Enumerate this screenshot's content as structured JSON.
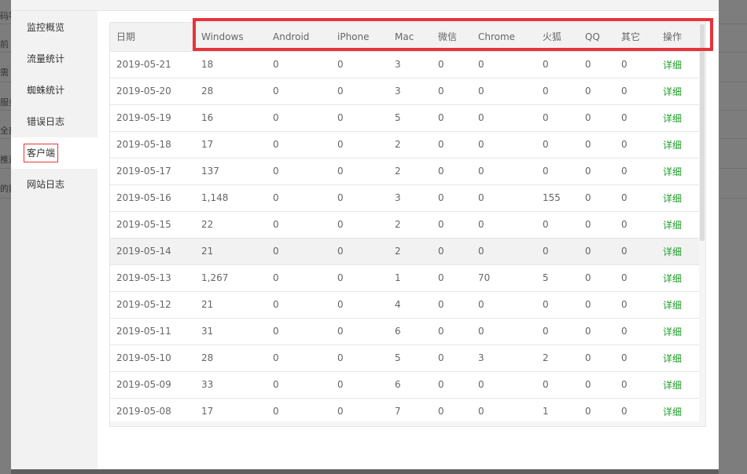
{
  "background": {
    "fragments": [
      "码等",
      "前",
      "需",
      "服务",
      "全部",
      "推送",
      "的数"
    ]
  },
  "sidebar": {
    "items": [
      {
        "label": "监控概览",
        "active": false
      },
      {
        "label": "流量统计",
        "active": false
      },
      {
        "label": "蜘蛛统计",
        "active": false
      },
      {
        "label": "错误日志",
        "active": false
      },
      {
        "label": "客户端",
        "active": true
      },
      {
        "label": "网站日志",
        "active": false
      }
    ]
  },
  "table": {
    "headers": [
      "日期",
      "Windows",
      "Android",
      "iPhone",
      "Mac",
      "微信",
      "Chrome",
      "火狐",
      "QQ",
      "其它",
      "操作"
    ],
    "action_label": "详细",
    "rows": [
      [
        "2019-05-21",
        "18",
        "0",
        "0",
        "3",
        "0",
        "0",
        "0",
        "0",
        "0"
      ],
      [
        "2019-05-20",
        "28",
        "0",
        "0",
        "3",
        "0",
        "0",
        "0",
        "0",
        "0"
      ],
      [
        "2019-05-19",
        "16",
        "0",
        "0",
        "5",
        "0",
        "0",
        "0",
        "0",
        "0"
      ],
      [
        "2019-05-18",
        "17",
        "0",
        "0",
        "2",
        "0",
        "0",
        "0",
        "0",
        "0"
      ],
      [
        "2019-05-17",
        "137",
        "0",
        "0",
        "2",
        "0",
        "0",
        "0",
        "0",
        "0"
      ],
      [
        "2019-05-16",
        "1,148",
        "0",
        "0",
        "3",
        "0",
        "0",
        "155",
        "0",
        "0"
      ],
      [
        "2019-05-15",
        "22",
        "0",
        "0",
        "2",
        "0",
        "0",
        "0",
        "0",
        "0"
      ],
      [
        "2019-05-14",
        "21",
        "0",
        "0",
        "2",
        "0",
        "0",
        "0",
        "0",
        "0"
      ],
      [
        "2019-05-13",
        "1,267",
        "0",
        "0",
        "1",
        "0",
        "70",
        "5",
        "0",
        "0"
      ],
      [
        "2019-05-12",
        "21",
        "0",
        "0",
        "4",
        "0",
        "0",
        "0",
        "0",
        "0"
      ],
      [
        "2019-05-11",
        "31",
        "0",
        "0",
        "6",
        "0",
        "0",
        "0",
        "0",
        "0"
      ],
      [
        "2019-05-10",
        "28",
        "0",
        "0",
        "5",
        "0",
        "3",
        "2",
        "0",
        "0"
      ],
      [
        "2019-05-09",
        "33",
        "0",
        "0",
        "6",
        "0",
        "0",
        "0",
        "0",
        "0"
      ],
      [
        "2019-05-08",
        "17",
        "0",
        "0",
        "7",
        "0",
        "0",
        "1",
        "0",
        "0"
      ]
    ],
    "hovered_row": 7
  },
  "colors": {
    "accent_green": "#1e9d27",
    "highlight_red": "#e8333a"
  }
}
